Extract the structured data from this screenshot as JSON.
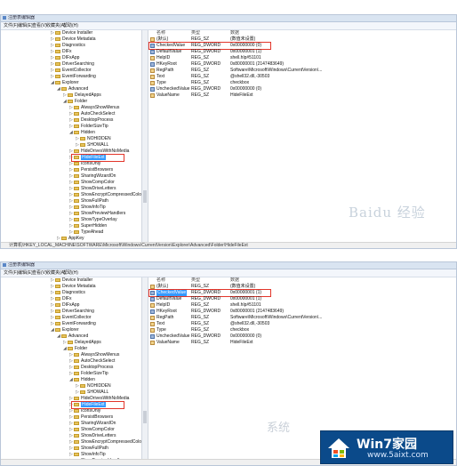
{
  "shots": [
    {
      "window_title": "注册表编辑器",
      "menu": [
        "文件(F)",
        "编辑(E)",
        "查看(V)",
        "收藏夹(A)",
        "帮助(H)"
      ],
      "tree": [
        {
          "label": "Device Installer",
          "indent": 0
        },
        {
          "label": "Device Metadata",
          "indent": 0
        },
        {
          "label": "Diagnostics",
          "indent": 0
        },
        {
          "label": "DIFx",
          "indent": 0
        },
        {
          "label": "DIFxApp",
          "indent": 0
        },
        {
          "label": "DriverSearching",
          "indent": 0
        },
        {
          "label": "EventCollector",
          "indent": 0
        },
        {
          "label": "EventForwarding",
          "indent": 0
        },
        {
          "label": "Explorer",
          "indent": 0,
          "expanded": true
        },
        {
          "label": "Advanced",
          "indent": 1,
          "expanded": true
        },
        {
          "label": "DelayedApps",
          "indent": 2
        },
        {
          "label": "Folder",
          "indent": 2,
          "expanded": true
        },
        {
          "label": "AlwaysShowMenus",
          "indent": 3
        },
        {
          "label": "AutoCheckSelect",
          "indent": 3
        },
        {
          "label": "DesktopProcess",
          "indent": 3
        },
        {
          "label": "FolderSizeTip",
          "indent": 3
        },
        {
          "label": "Hidden",
          "indent": 3,
          "expanded": true
        },
        {
          "label": "NOHIDDEN",
          "indent": 4
        },
        {
          "label": "SHOWALL",
          "indent": 4
        },
        {
          "label": "HideDrivesWithNoMedia",
          "indent": 3
        },
        {
          "label": "HideFileExt",
          "indent": 3,
          "selected": true
        },
        {
          "label": "IconsOnly",
          "indent": 3
        },
        {
          "label": "PersistBrowsers",
          "indent": 3
        },
        {
          "label": "SharingWizardOn",
          "indent": 3
        },
        {
          "label": "ShowCompColor",
          "indent": 3
        },
        {
          "label": "ShowDriveLetters",
          "indent": 3
        },
        {
          "label": "ShowEncryptCompressedColor",
          "indent": 3
        },
        {
          "label": "ShowFullPath",
          "indent": 3
        },
        {
          "label": "ShowInfoTip",
          "indent": 3
        },
        {
          "label": "ShowPreviewHandlers",
          "indent": 3
        },
        {
          "label": "ShowTypeOverlay",
          "indent": 3
        },
        {
          "label": "SuperHidden",
          "indent": 3
        },
        {
          "label": "TypeAhead",
          "indent": 3
        },
        {
          "label": "AppKey",
          "indent": 1
        },
        {
          "label": "Associations",
          "indent": 1
        }
      ],
      "columns": {
        "name": "名称",
        "type": "类型",
        "data": "数据"
      },
      "values": [
        {
          "icon": "string-value-icon",
          "name": "(默认)",
          "type": "REG_SZ",
          "data": "(数值未设置)"
        },
        {
          "icon": "binary-value-icon",
          "name": "CheckedValue",
          "type": "REG_DWORD",
          "data": "0x00000000 (0)"
        },
        {
          "icon": "binary-value-icon",
          "name": "DefaultValue",
          "type": "REG_DWORD",
          "data": "0x00000001 (1)"
        },
        {
          "icon": "string-value-icon",
          "name": "HelpID",
          "type": "REG_SZ",
          "data": "shell.hlp#51101"
        },
        {
          "icon": "binary-value-icon",
          "name": "HKeyRoot",
          "type": "REG_DWORD",
          "data": "0x80000001 (2147483649)"
        },
        {
          "icon": "string-value-icon",
          "name": "RegPath",
          "type": "REG_SZ",
          "data": "Software\\Microsoft\\Windows\\CurrentVersion\\..."
        },
        {
          "icon": "string-value-icon",
          "name": "Text",
          "type": "REG_SZ",
          "data": "@shell32.dll,-30503"
        },
        {
          "icon": "string-value-icon",
          "name": "Type",
          "type": "REG_SZ",
          "data": "checkbox"
        },
        {
          "icon": "binary-value-icon",
          "name": "UncheckedValue",
          "type": "REG_DWORD",
          "data": "0x00000000 (0)"
        },
        {
          "icon": "string-value-icon",
          "name": "ValueName",
          "type": "REG_SZ",
          "data": "HideFileExt"
        }
      ],
      "selected_value": null,
      "status": "计算机\\HKEY_LOCAL_MACHINE\\SOFTWARE\\Microsoft\\Windows\\CurrentVersion\\Explorer\\Advanced\\Folder\\HideFileExt"
    },
    {
      "window_title": "注册表编辑器",
      "menu": [
        "文件(F)",
        "编辑(E)",
        "查看(V)",
        "收藏夹(A)",
        "帮助(H)"
      ],
      "tree": [
        {
          "label": "Device Installer",
          "indent": 0
        },
        {
          "label": "Device Metadata",
          "indent": 0
        },
        {
          "label": "Diagnostics",
          "indent": 0
        },
        {
          "label": "DIFx",
          "indent": 0
        },
        {
          "label": "DIFxApp",
          "indent": 0
        },
        {
          "label": "DriverSearching",
          "indent": 0
        },
        {
          "label": "EventCollector",
          "indent": 0
        },
        {
          "label": "EventForwarding",
          "indent": 0
        },
        {
          "label": "Explorer",
          "indent": 0,
          "expanded": true
        },
        {
          "label": "Advanced",
          "indent": 1,
          "expanded": true
        },
        {
          "label": "DelayedApps",
          "indent": 2
        },
        {
          "label": "Folder",
          "indent": 2,
          "expanded": true
        },
        {
          "label": "AlwaysShowMenus",
          "indent": 3
        },
        {
          "label": "AutoCheckSelect",
          "indent": 3
        },
        {
          "label": "DesktopProcess",
          "indent": 3
        },
        {
          "label": "FolderSizeTip",
          "indent": 3
        },
        {
          "label": "Hidden",
          "indent": 3,
          "expanded": true
        },
        {
          "label": "NOHIDDEN",
          "indent": 4
        },
        {
          "label": "SHOWALL",
          "indent": 4
        },
        {
          "label": "HideDrivesWithNoMedia",
          "indent": 3
        },
        {
          "label": "HideFileExt",
          "indent": 3,
          "selected": true
        },
        {
          "label": "IconsOnly",
          "indent": 3
        },
        {
          "label": "PersistBrowsers",
          "indent": 3
        },
        {
          "label": "SharingWizardOn",
          "indent": 3
        },
        {
          "label": "ShowCompColor",
          "indent": 3
        },
        {
          "label": "ShowDriveLetters",
          "indent": 3
        },
        {
          "label": "ShowEncryptCompressedColor",
          "indent": 3
        },
        {
          "label": "ShowFullPath",
          "indent": 3
        },
        {
          "label": "ShowInfoTip",
          "indent": 3
        },
        {
          "label": "ShowPreviewHandlers",
          "indent": 3
        }
      ],
      "columns": {
        "name": "名称",
        "type": "类型",
        "data": "数据"
      },
      "values": [
        {
          "icon": "string-value-icon",
          "name": "(默认)",
          "type": "REG_SZ",
          "data": "(数值未设置)"
        },
        {
          "icon": "binary-value-icon",
          "name": "CheckedValue",
          "type": "REG_DWORD",
          "data": "0x00000001 (1)"
        },
        {
          "icon": "binary-value-icon",
          "name": "DefaultValue",
          "type": "REG_DWORD",
          "data": "0x00000001 (1)"
        },
        {
          "icon": "string-value-icon",
          "name": "HelpID",
          "type": "REG_SZ",
          "data": "shell.hlp#51101"
        },
        {
          "icon": "binary-value-icon",
          "name": "HKeyRoot",
          "type": "REG_DWORD",
          "data": "0x80000001 (2147483649)"
        },
        {
          "icon": "string-value-icon",
          "name": "RegPath",
          "type": "REG_SZ",
          "data": "Software\\Microsoft\\Windows\\CurrentVersion\\..."
        },
        {
          "icon": "string-value-icon",
          "name": "Text",
          "type": "REG_SZ",
          "data": "@shell32.dll,-30503"
        },
        {
          "icon": "string-value-icon",
          "name": "Type",
          "type": "REG_SZ",
          "data": "checkbox"
        },
        {
          "icon": "binary-value-icon",
          "name": "UncheckedValue",
          "type": "REG_DWORD",
          "data": "0x00000000 (0)"
        },
        {
          "icon": "string-value-icon",
          "name": "ValueName",
          "type": "REG_SZ",
          "data": "HideFileExt"
        }
      ],
      "selected_value": 1,
      "status": ""
    }
  ],
  "watermark": {
    "baidu": "Baidu 经验",
    "system": "系统"
  },
  "logo": {
    "title": "Win7家园",
    "url": "www.5aixt.com"
  },
  "colors": {
    "highlight_box": "#e2352a",
    "selection": "#3399ff",
    "logo_bg": "#0b4a8a"
  }
}
